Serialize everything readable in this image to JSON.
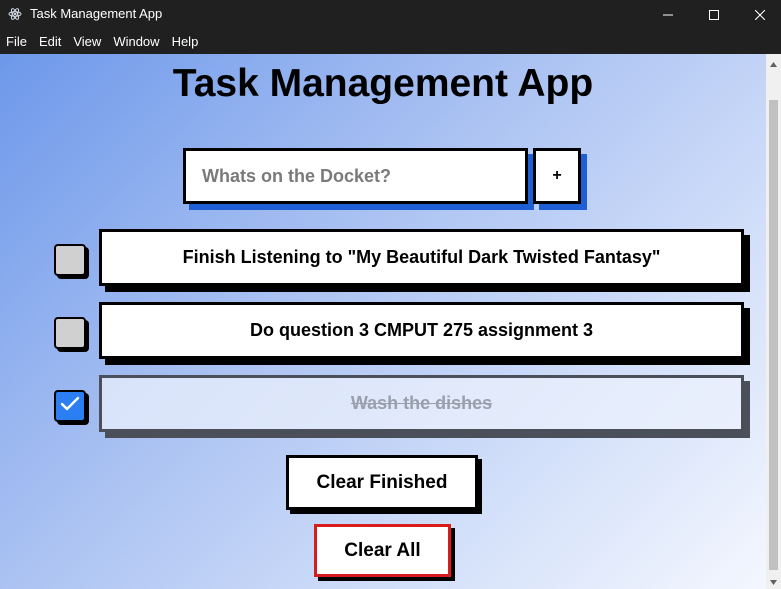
{
  "window": {
    "title": "Task Management App",
    "icon": "electron-atom-icon",
    "controls": [
      "minimize-icon",
      "maximize-icon",
      "close-icon"
    ]
  },
  "menu": {
    "items": [
      "File",
      "Edit",
      "View",
      "Window",
      "Help"
    ]
  },
  "page": {
    "title": "Task Management App"
  },
  "new_task": {
    "placeholder": "Whats on the Docket?",
    "value": "",
    "add_label": "+"
  },
  "tasks": [
    {
      "text": "Finish Listening to \"My Beautiful Dark Twisted Fantasy\"",
      "done": false
    },
    {
      "text": "Do question 3 CMPUT 275 assignment 3",
      "done": false
    },
    {
      "text": "Wash the dishes",
      "done": true
    }
  ],
  "actions": {
    "clear_finished_label": "Clear Finished",
    "clear_all_label": "Clear All"
  },
  "colors": {
    "accent_shadow": "#1f5fd6",
    "checkbox_checked": "#2b7ff2",
    "clear_all_border": "#d81b1b",
    "titlebar": "#202020"
  }
}
